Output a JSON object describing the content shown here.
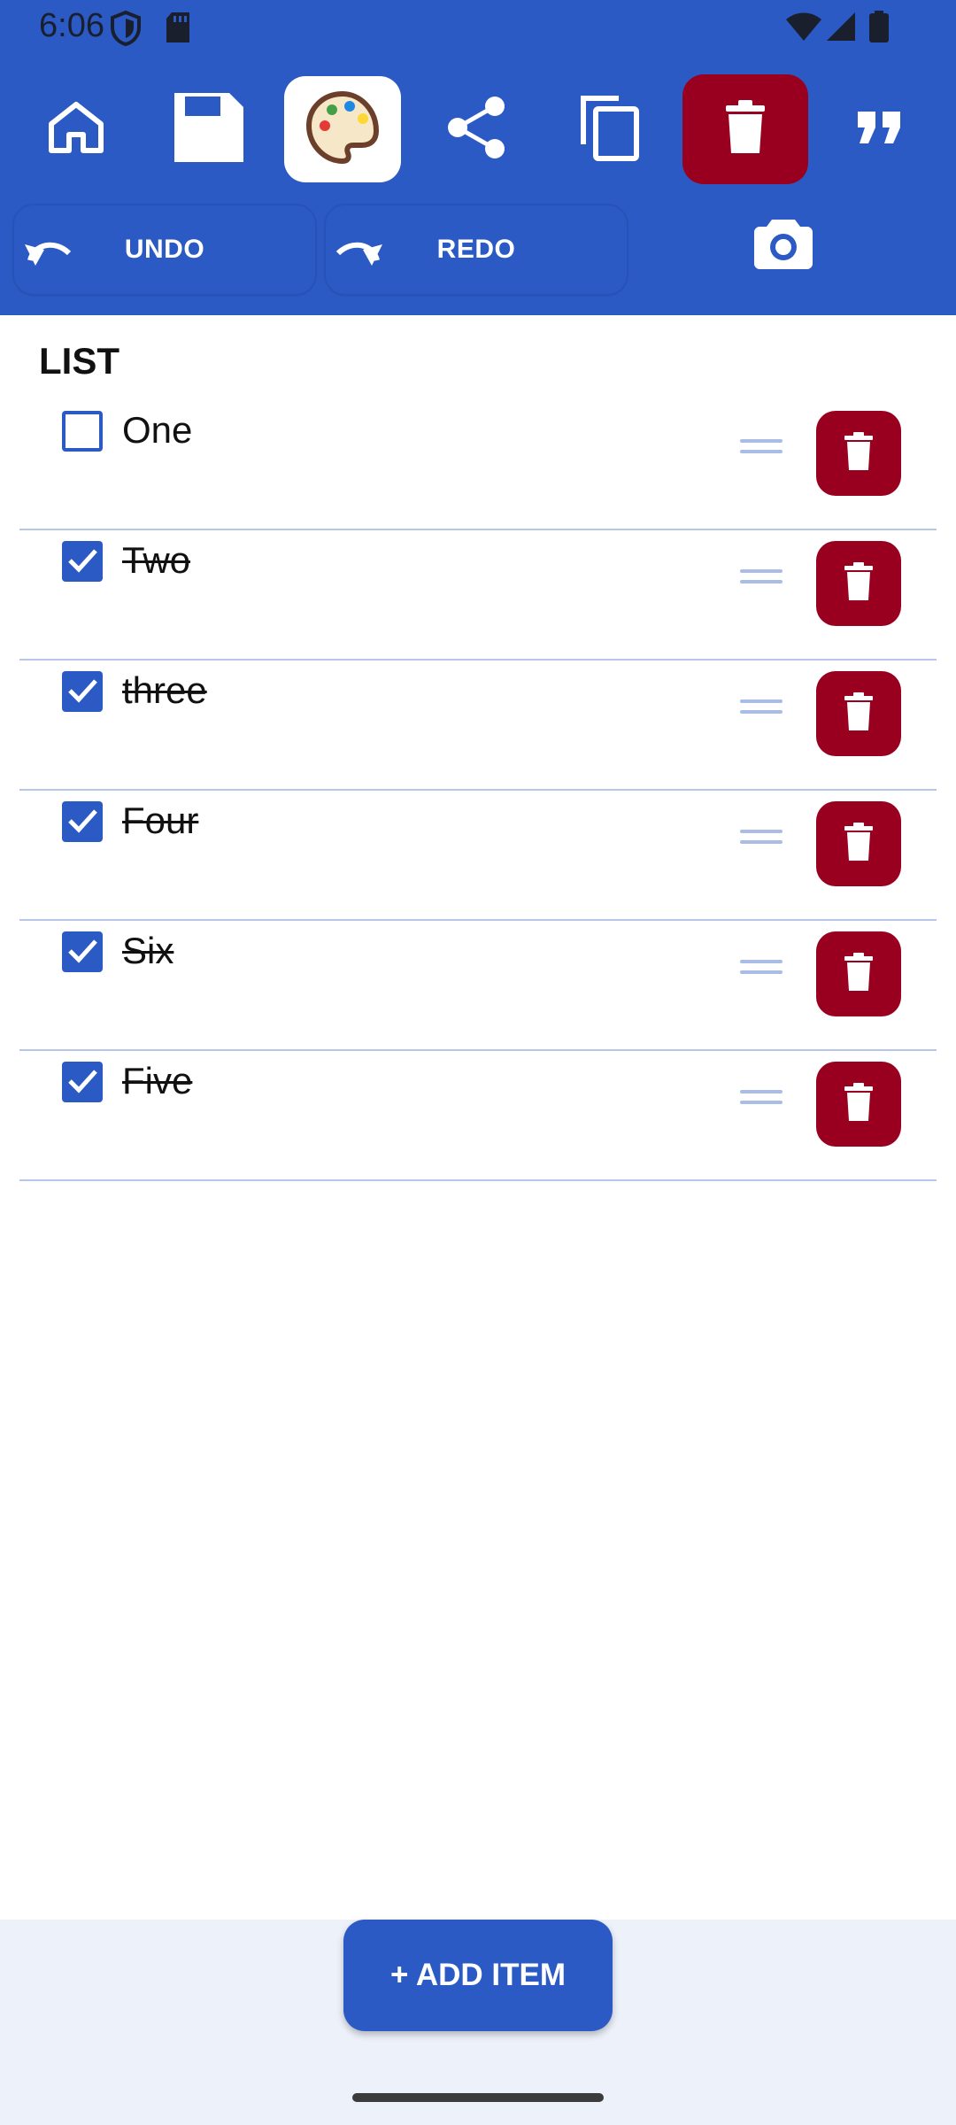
{
  "status_bar": {
    "time": "6:06",
    "icons": [
      "shield-icon",
      "sd-card-icon",
      "wifi-icon",
      "signal-icon",
      "battery-icon"
    ]
  },
  "toolbar": {
    "buttons": [
      {
        "name": "home-icon",
        "state": "normal"
      },
      {
        "name": "save-icon",
        "state": "normal"
      },
      {
        "name": "palette-icon",
        "state": "active"
      },
      {
        "name": "share-icon",
        "state": "normal"
      },
      {
        "name": "copy-icon",
        "state": "normal"
      },
      {
        "name": "delete-icon",
        "state": "danger"
      },
      {
        "name": "quote-icon",
        "state": "normal"
      }
    ]
  },
  "actions": {
    "undo_label": "UNDO",
    "redo_label": "REDO"
  },
  "list": {
    "title": "LIST",
    "items": [
      {
        "text": "One",
        "checked": false
      },
      {
        "text": "Two",
        "checked": true
      },
      {
        "text": "three",
        "checked": true
      },
      {
        "text": "Four",
        "checked": true
      },
      {
        "text": "Six",
        "checked": true
      },
      {
        "text": "Five",
        "checked": true
      }
    ]
  },
  "add_item_label": "+ ADD ITEM",
  "colors": {
    "primary": "#2c5ac4",
    "danger": "#990020",
    "divider": "#b7c6e8",
    "bottom_bg": "#edf1fa"
  }
}
